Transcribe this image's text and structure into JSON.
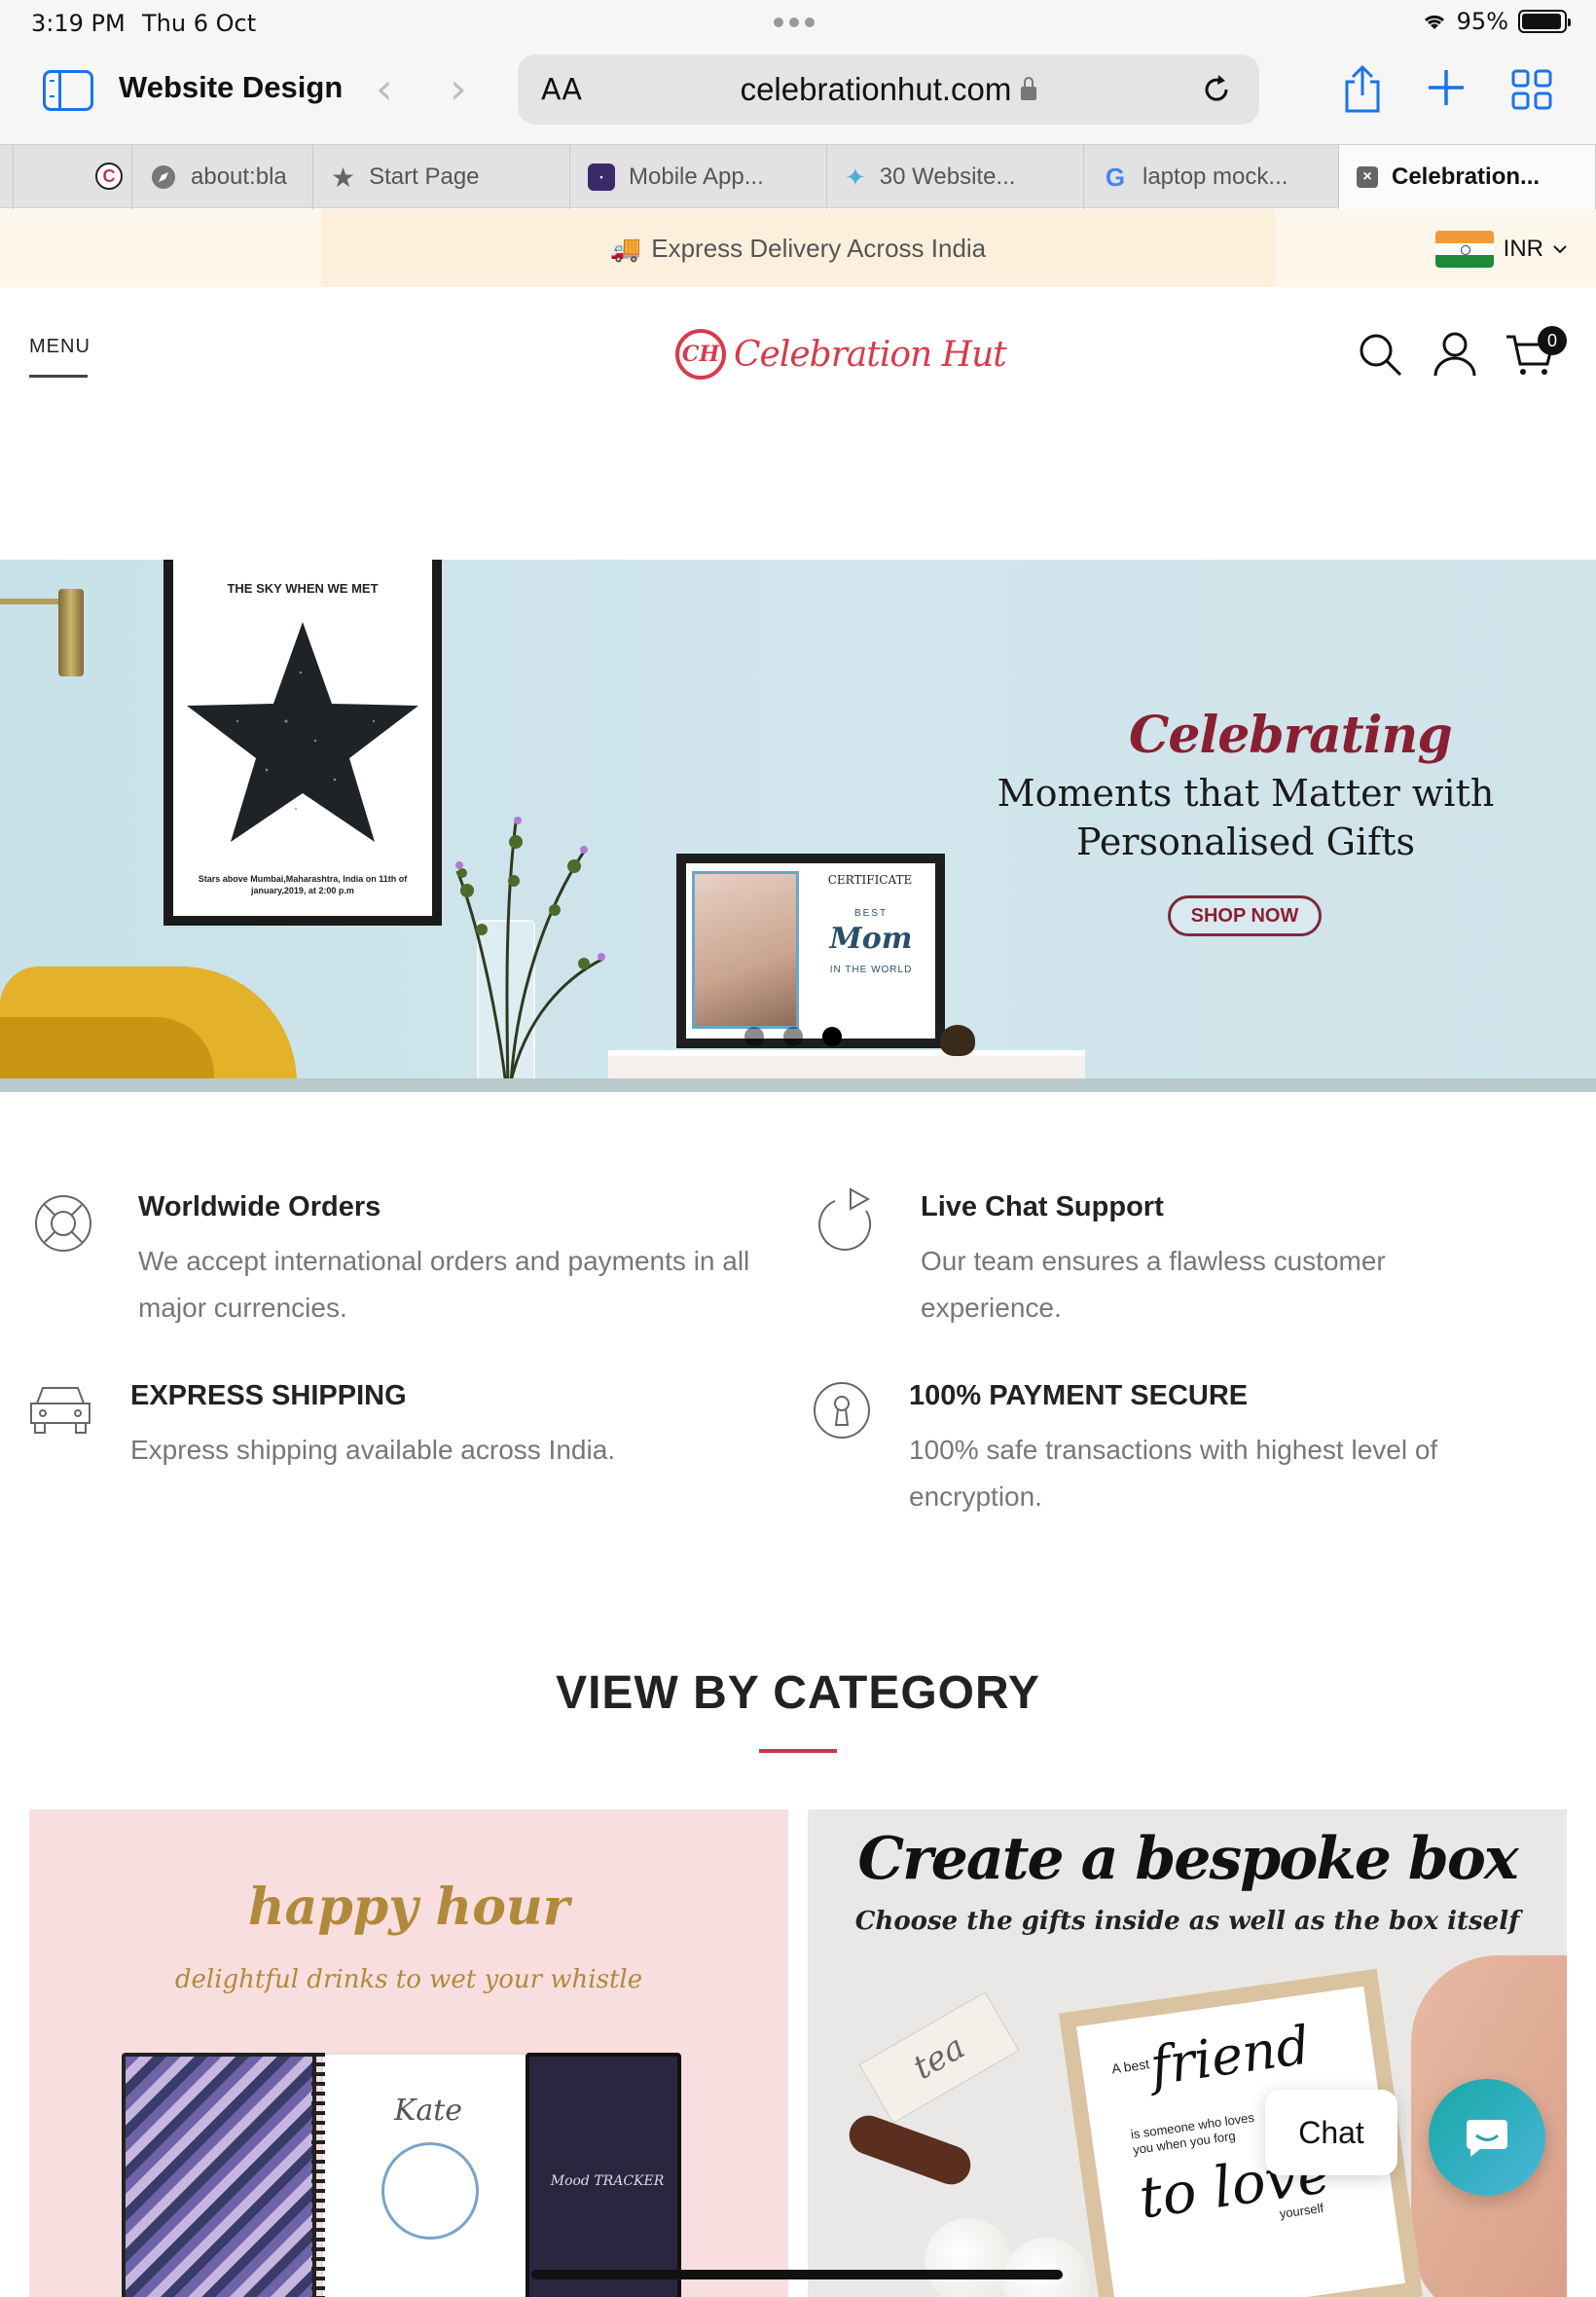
{
  "status_bar": {
    "time": "3:19 PM",
    "date": "Thu 6 Oct",
    "battery": "95%",
    "battery_level": 0.95
  },
  "toolbar": {
    "title": "Website Design",
    "back_glyph": "‹",
    "forward_glyph": "›",
    "url_aa": "AA",
    "url": "celebrationhut.com",
    "icons": [
      "sidebar-icon",
      "share-icon",
      "new-tab-icon",
      "tabs-overview-icon",
      "reload-icon",
      "lock-icon"
    ]
  },
  "tabs": [
    {
      "label": "",
      "favicon": "C",
      "fav_bg": "#ffffff",
      "fav_color": "#d63c4c"
    },
    {
      "label": "about:bla",
      "favicon": "compass-icon"
    },
    {
      "label": "Start Page",
      "favicon": "star-icon"
    },
    {
      "label": "Mobile App...",
      "favicon": "app-icon"
    },
    {
      "label": "30 Website...",
      "favicon": "bird-icon"
    },
    {
      "label": "laptop mock...",
      "favicon": "G"
    },
    {
      "label": "Celebration...",
      "favicon": "close-icon",
      "active": true
    }
  ],
  "announcement": {
    "text": "Express Delivery Across India",
    "icon": "truck-icon"
  },
  "currency": {
    "code": "INR",
    "flag": "india-flag"
  },
  "header": {
    "menu_label": "MENU",
    "logo_text": "Celebration Hut",
    "logo_mark": "CH",
    "cart_count": "0"
  },
  "hero": {
    "poster_title": "THE SKY WHEN WE MET",
    "poster_sub": "Stars above Mumbai,Maharashtra, India on 11th of january,2019, at 2:00 p.m",
    "cert_head": "CERTIFICATE",
    "cert_best": "BEST",
    "cert_mom": "Mom",
    "cert_world": "IN THE WORLD",
    "script": "Celebrating",
    "line1": "Moments that Matter with",
    "line2": "Personalised Gifts",
    "cta": "SHOP NOW",
    "slides": 3,
    "active_slide": 3
  },
  "features": [
    {
      "title": "Worldwide Orders",
      "desc": "We accept international orders and payments in all major currencies.",
      "icon": "lifebuoy-icon"
    },
    {
      "title": "Live Chat Support",
      "desc": "Our team ensures a flawless customer experience.",
      "icon": "refresh-arrow-icon"
    },
    {
      "title": "EXPRESS SHIPPING",
      "desc": "Express shipping available across India.",
      "icon": "car-icon"
    },
    {
      "title": "100% PAYMENT SECURE",
      "desc": "100% safe transactions with highest level of encryption.",
      "icon": "keyhole-icon"
    }
  ],
  "category": {
    "title": "VIEW BY CATEGORY",
    "accent": "#c0394b",
    "cards": [
      {
        "script": "happy hour",
        "sub": "delightful drinks to wet your whistle",
        "nb_name": "Kate",
        "nb_tracker": "Mood TRACKER"
      },
      {
        "script": "Create a bespoke box",
        "sub": "Choose the gifts inside as well as the box itself",
        "tag": "tea",
        "frame_a": "A best",
        "frame_b": "friend",
        "frame_c": "is someone who loves you when you forg",
        "frame_d": "to love",
        "frame_e": "yourself"
      }
    ]
  },
  "chat": {
    "label": "Chat"
  }
}
